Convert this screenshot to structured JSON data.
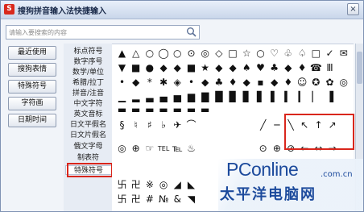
{
  "window": {
    "title": "搜狗拼音输入法快捷输入",
    "close_label": "×",
    "app_icon": "S"
  },
  "search": {
    "placeholder": "请输入要搜索的内容"
  },
  "sidebar": [
    {
      "label": "最近使用"
    },
    {
      "label": "搜狗表情"
    },
    {
      "label": "特殊符号"
    },
    {
      "label": "字符画"
    },
    {
      "label": "日期时间"
    }
  ],
  "categories": [
    {
      "label": "标点符号"
    },
    {
      "label": "数字序号"
    },
    {
      "label": "数学/单位"
    },
    {
      "label": "希腊/拉丁"
    },
    {
      "label": "拼音/注音"
    },
    {
      "label": "中文字符"
    },
    {
      "label": "英文音标"
    },
    {
      "label": "日文平假名"
    },
    {
      "label": "日文片假名"
    },
    {
      "label": "俄文字母"
    },
    {
      "label": "制表符"
    },
    {
      "label": "特殊符号"
    }
  ],
  "symbols": {
    "row1": [
      "▲",
      "△",
      "○",
      "◯",
      "○",
      "⊙",
      "◎",
      "◇",
      "□",
      "☆",
      "○",
      "♡",
      "♧",
      "♤",
      "□",
      "✓",
      "✉"
    ],
    "row2": [
      "▼",
      "■",
      "●",
      "◆",
      "◆",
      "■",
      "★",
      "◆",
      "◆",
      "♠",
      "♥",
      "♣",
      "◆",
      "♦",
      "☎",
      "Ⅲ"
    ],
    "row3": [
      "•",
      "◆",
      "*",
      "✱",
      "◈",
      "•",
      "◆",
      "♣",
      "♦",
      "◆",
      "▪",
      "◆",
      "♦",
      "☺",
      "✪",
      "✿",
      "◎"
    ],
    "row4": [
      "▁",
      "▂",
      "▃",
      "▄",
      "▅",
      "▆",
      "▇",
      "█",
      "▉",
      "▊",
      "▋",
      "▌",
      "▍",
      "▎",
      "▏",
      "▐"
    ],
    "row5": [
      "▬",
      "▬",
      "▬",
      "▬",
      "▬",
      "▬",
      "▬"
    ],
    "row6": [
      "§",
      "♮",
      "♯",
      "♭",
      "✈",
      "⌒",
      "╱",
      "─",
      "╲",
      "↖",
      "↑",
      "↗"
    ],
    "row7": [
      "◎",
      "⊕",
      "☞",
      "TEL",
      "℡",
      "♨",
      "⊙",
      "⊕",
      "⊘",
      "←",
      "↔",
      "→"
    ],
    "row8": [
      "卐",
      "卍",
      "※",
      "◎",
      "◢",
      "◣"
    ],
    "row9": [
      "卐",
      "卍",
      "#",
      "№",
      "&",
      "◥"
    ]
  },
  "watermark": {
    "brand": "PConline",
    "domain": ".com.cn",
    "subtitle": "太平洋电脑网"
  }
}
